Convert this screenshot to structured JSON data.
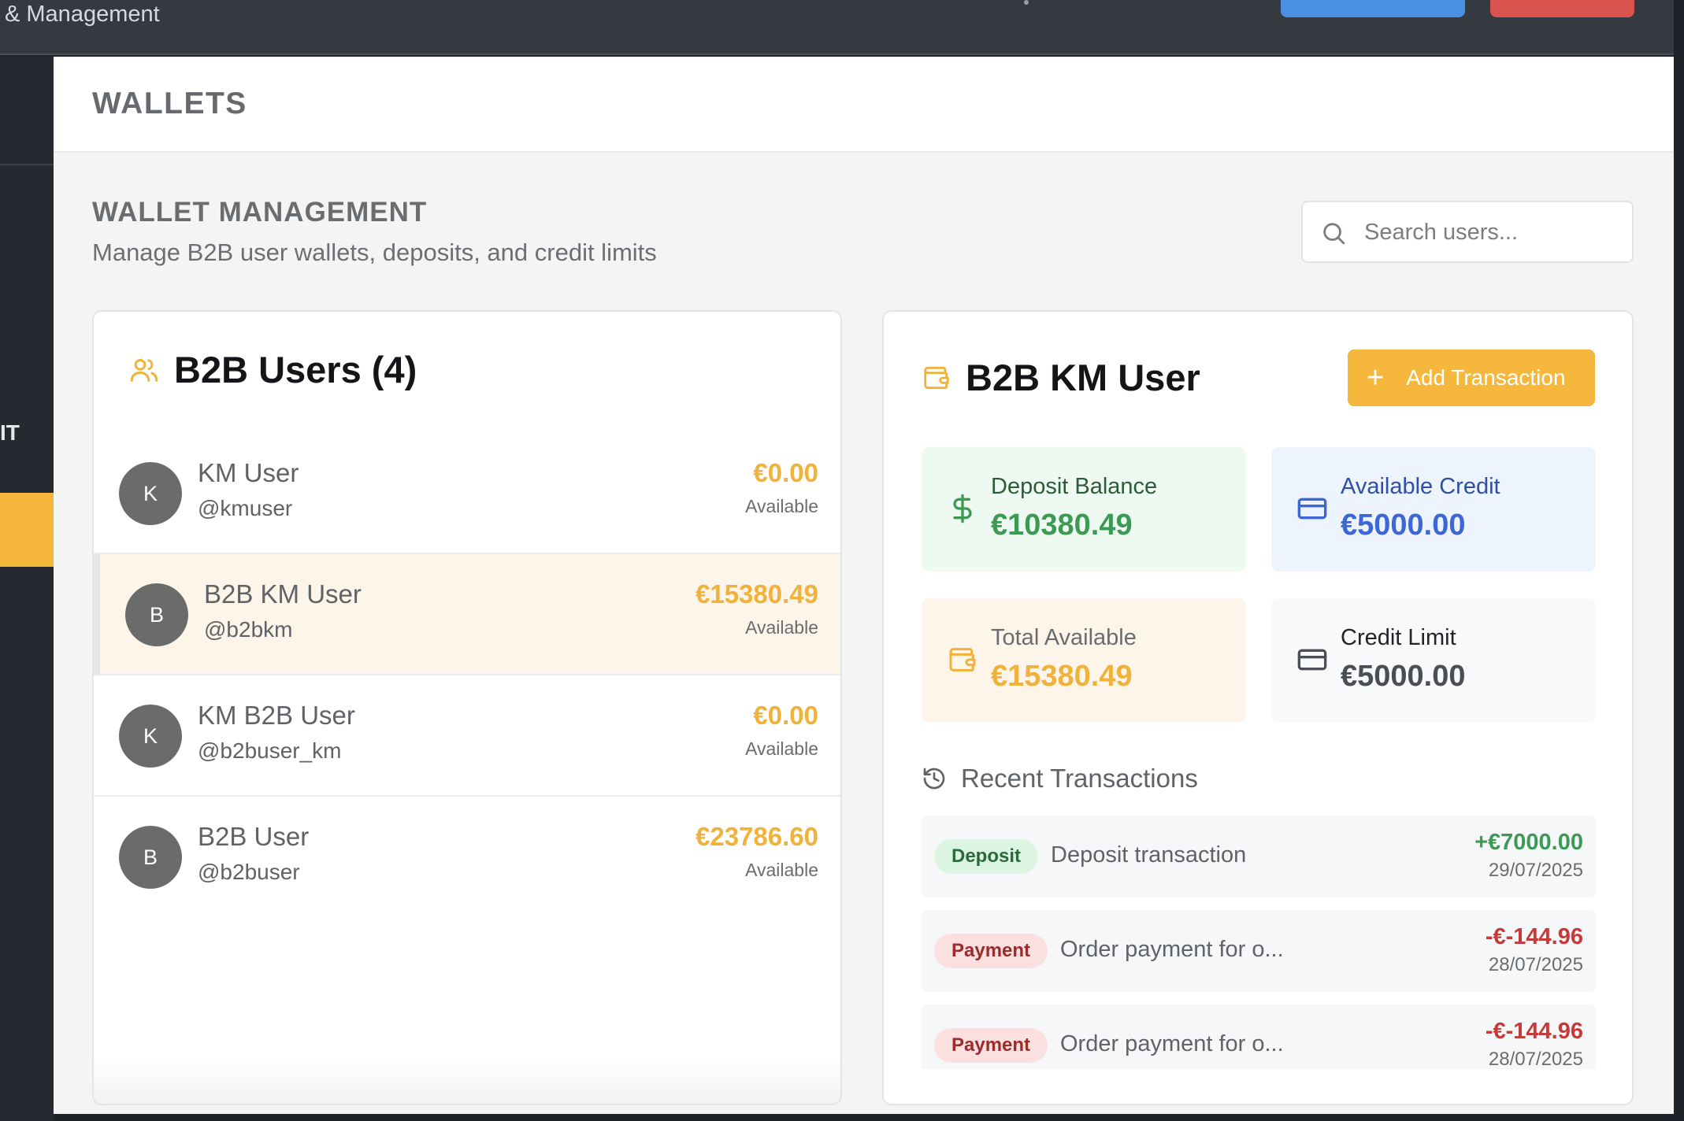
{
  "topbar": {
    "brand_text": "& Management"
  },
  "sidebar": {
    "nav_item_partial": "IT"
  },
  "page": {
    "title": "WALLETS"
  },
  "section": {
    "title": "WALLET MANAGEMENT",
    "subtitle": "Manage B2B user wallets, deposits, and credit limits"
  },
  "search": {
    "placeholder": "Search users..."
  },
  "users_panel": {
    "title": "B2B Users (4)",
    "icon": "users-icon",
    "users": [
      {
        "initial": "K",
        "name": "KM User",
        "handle": "@kmuser",
        "amount": "€0.00",
        "available_label": "Available"
      },
      {
        "initial": "B",
        "name": "B2B KM User",
        "handle": "@b2bkm",
        "amount": "€15380.49",
        "available_label": "Available",
        "selected": true
      },
      {
        "initial": "K",
        "name": "KM B2B User",
        "handle": "@b2buser_km",
        "amount": "€0.00",
        "available_label": "Available"
      },
      {
        "initial": "B",
        "name": "B2B User",
        "handle": "@b2buser",
        "amount": "€23786.60",
        "available_label": "Available"
      }
    ]
  },
  "detail": {
    "title": "B2B KM User",
    "icon": "wallet-icon",
    "add_button_label": "Add Transaction",
    "stats": {
      "deposit": {
        "label": "Deposit Balance",
        "value": "€10380.49",
        "icon": "dollar-icon",
        "color": "#3c9a55"
      },
      "credit": {
        "label": "Available Credit",
        "value": "€5000.00",
        "icon": "credit-card-icon",
        "color": "#3d67d4"
      },
      "total": {
        "label": "Total Available",
        "value": "€15380.49",
        "icon": "wallet-icon",
        "color": "#f0b23b"
      },
      "limit": {
        "label": "Credit Limit",
        "value": "€5000.00",
        "icon": "credit-card-icon",
        "color": "#4b4f55"
      }
    },
    "recent_title": "Recent Transactions",
    "transactions": [
      {
        "type": "Deposit",
        "description": "Deposit transaction",
        "amount": "+€7000.00",
        "date": "29/07/2025"
      },
      {
        "type": "Payment",
        "description": "Order payment for o...",
        "amount": "-€-144.96",
        "date": "28/07/2025"
      },
      {
        "type": "Payment",
        "description": "Order payment for o...",
        "amount": "-€-144.96",
        "date": "28/07/2025"
      }
    ]
  },
  "colors": {
    "accent": "#f5b83d",
    "sidebar": "#262a30",
    "topbar": "#353a40"
  }
}
